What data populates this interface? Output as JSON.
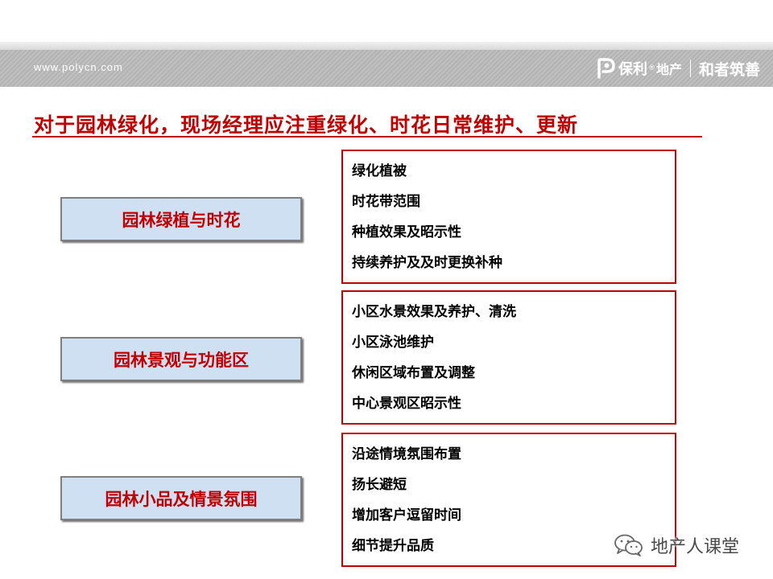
{
  "header": {
    "url": "www.polycn.com",
    "brand": "保利",
    "registered": "®",
    "brand_sub": "地产",
    "slogan": "和者筑善",
    "accent": "#b9b9b9"
  },
  "title": "对于园林绿化，现场经理应注重绿化、时花日常维护、更新",
  "title_color": "#c00000",
  "sections": [
    {
      "category": "园林绿植与时花",
      "items": [
        "绿化植被",
        "时花带范围",
        "种植效果及昭示性",
        "持续养护及及时更换补种"
      ]
    },
    {
      "category": "园林景观与功能区",
      "items": [
        "小区水景效果及养护、清洗",
        "小区泳池维护",
        "休闲区域布置及调整",
        "中心景观区昭示性"
      ]
    },
    {
      "category": "园林小品及情景氛围",
      "items": [
        "沿途情境氛围布置",
        "扬长避短",
        "增加客户逗留时间",
        "细节提升品质"
      ]
    }
  ],
  "category_fill": "#cfe0f3",
  "watermark": {
    "icon": "wechat-icon",
    "text": "地产人课堂"
  }
}
